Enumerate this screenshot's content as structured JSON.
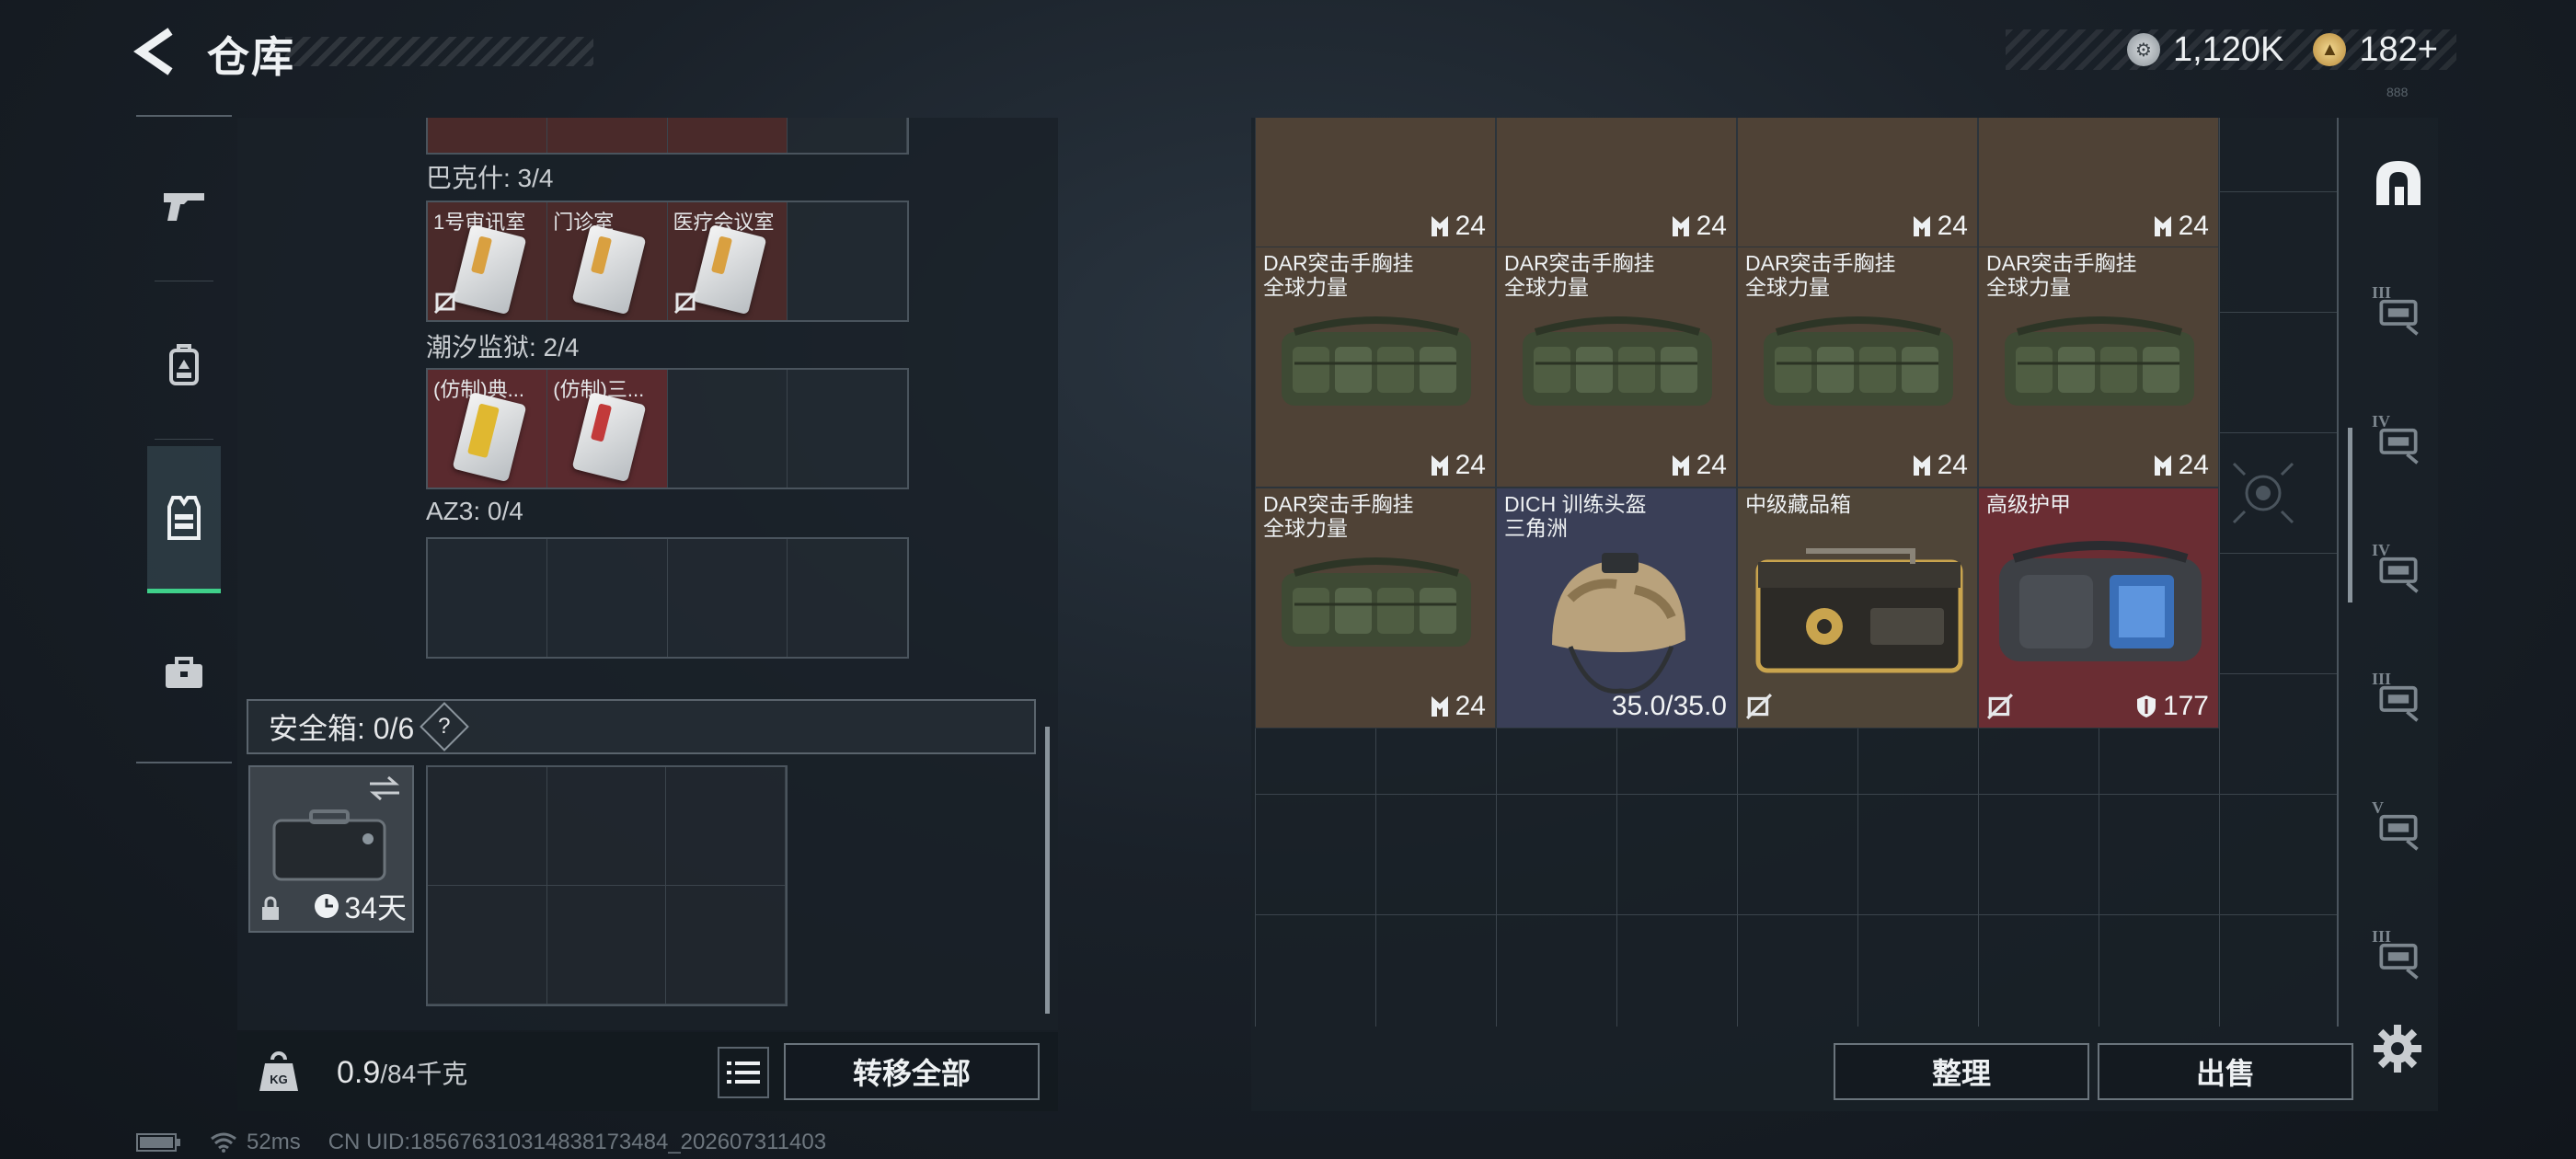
{
  "header": {
    "title": "仓库",
    "currencies": [
      {
        "icon": "silver-coin-icon",
        "value": "1,120K"
      },
      {
        "icon": "gold-coin-icon",
        "value": "182",
        "plus": "+"
      }
    ],
    "tiny_tag": "888"
  },
  "left_nav": {
    "items": [
      {
        "name": "weapons",
        "icon": "pistol-icon"
      },
      {
        "name": "backpack",
        "icon": "backpack-icon"
      },
      {
        "name": "armor-rig",
        "icon": "vest-icon",
        "active": true
      },
      {
        "name": "toolbox",
        "icon": "briefcase-icon"
      }
    ]
  },
  "key_groups": [
    {
      "label": "巴克什: 3/4",
      "slots": [
        {
          "label": "1号审讯室",
          "card": "white",
          "nouse": true
        },
        {
          "label": "门诊室",
          "card": "white",
          "nouse": false
        },
        {
          "label": "医疗会议室",
          "card": "white",
          "nouse": true
        },
        null
      ]
    },
    {
      "label": "潮汐监狱: 2/4",
      "slots": [
        {
          "label": "(仿制)典...",
          "card": "gold",
          "nouse": false
        },
        {
          "label": "(仿制)三...",
          "card": "red",
          "nouse": false
        },
        null,
        null
      ]
    },
    {
      "label": "AZ3: 0/4",
      "slots": [
        null,
        null,
        null,
        null
      ]
    }
  ],
  "safe_box": {
    "label": "安全箱:",
    "count": "0/6",
    "help": "?",
    "duration": "34天"
  },
  "weight": {
    "current": "0.9",
    "max": "/84千克",
    "kg_label": "KG"
  },
  "buttons": {
    "transfer_all": "转移全部",
    "sort": "整理",
    "sell": "出售"
  },
  "stash_items": [
    {
      "name": "",
      "count": "24",
      "type": "rig",
      "col": 0,
      "row": -1
    },
    {
      "name": "",
      "count": "24",
      "type": "rig",
      "col": 1,
      "row": -1
    },
    {
      "name": "",
      "count": "24",
      "type": "rig",
      "col": 2,
      "row": -1
    },
    {
      "name": "",
      "count": "24",
      "type": "rig",
      "col": 3,
      "row": -1
    },
    {
      "name": "DAR突击手胸挂\n全球力量",
      "count": "24",
      "type": "rig",
      "col": 0,
      "row": 0
    },
    {
      "name": "DAR突击手胸挂\n全球力量",
      "count": "24",
      "type": "rig",
      "col": 1,
      "row": 0
    },
    {
      "name": "DAR突击手胸挂\n全球力量",
      "count": "24",
      "type": "rig",
      "col": 2,
      "row": 0
    },
    {
      "name": "DAR突击手胸挂\n全球力量",
      "count": "24",
      "type": "rig",
      "col": 3,
      "row": 0
    },
    {
      "name": "DAR突击手胸挂\n全球力量",
      "count": "24",
      "type": "rig",
      "col": 0,
      "row": 1
    },
    {
      "name": "DICH 训练头盔\n三角洲",
      "count": "35.0/35.0",
      "type": "helmet",
      "col": 1,
      "row": 1
    },
    {
      "name": "中级藏品箱",
      "count": "",
      "type": "case",
      "col": 2,
      "row": 1
    },
    {
      "name": "高级护甲",
      "count": "177",
      "type": "armor",
      "col": 3,
      "row": 1
    }
  ],
  "right_icons": [
    {
      "name": "stash-home-icon",
      "num": ""
    },
    {
      "name": "weapon-tier-icon",
      "num": "III"
    },
    {
      "name": "folder-tier-icon",
      "num": "IV"
    },
    {
      "name": "medkit-tier-icon",
      "num": "IV"
    },
    {
      "name": "warning-tier-icon",
      "num": "III"
    },
    {
      "name": "gadget-tier-icon",
      "num": "V"
    },
    {
      "name": "tool-tier-icon",
      "num": "III"
    }
  ],
  "status": {
    "ping": "52ms",
    "uid": "CN UID:185676310314838173484_202607311403"
  },
  "colors": {
    "accent_green": "#3fd08a",
    "item_brown": "#4f4236",
    "item_red": "#6a2d33",
    "item_blue": "#3a3f57"
  }
}
